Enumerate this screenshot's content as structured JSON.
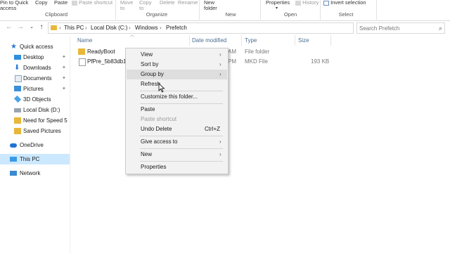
{
  "ribbon": {
    "pin_label": "Pin to Quick",
    "pin_label2": "access",
    "copy_label": "Copy",
    "paste_label": "Paste",
    "paste_shortcut_label": "Paste shortcut",
    "move_label": "Move",
    "move_label2": "to",
    "copy_to_label": "Copy",
    "copy_to_label2": "to",
    "delete_label": "Delete",
    "rename_label": "Rename",
    "new_folder_label": "New",
    "new_folder_label2": "folder",
    "properties_label": "Properties",
    "history_label": "History",
    "invert_label": "Invert selection",
    "groups": {
      "clipboard": "Clipboard",
      "organize": "Organize",
      "new": "New",
      "open": "Open",
      "select": "Select"
    }
  },
  "address": {
    "crumbs": [
      "This PC",
      "Local Disk (C:)",
      "Windows",
      "Prefetch"
    ],
    "search_placeholder": "Search Prefetch"
  },
  "sidebar": {
    "items": [
      {
        "label": "Quick access",
        "icon": "star-icon",
        "pinned": false
      },
      {
        "label": "Desktop",
        "icon": "desktop-icon",
        "pinned": true
      },
      {
        "label": "Downloads",
        "icon": "downloads-icon",
        "pinned": true
      },
      {
        "label": "Documents",
        "icon": "documents-icon",
        "pinned": true
      },
      {
        "label": "Pictures",
        "icon": "pictures-icon",
        "pinned": true
      },
      {
        "label": "3D Objects",
        "icon": "3d-objects-icon",
        "pinned": false
      },
      {
        "label": "Local Disk (D:)",
        "icon": "drive-icon",
        "pinned": false
      },
      {
        "label": "Need for Speed 5",
        "icon": "folder-icon",
        "pinned": false
      },
      {
        "label": "Saved Pictures",
        "icon": "folder-icon",
        "pinned": false
      },
      {
        "label": "OneDrive",
        "icon": "cloud-icon",
        "pinned": false
      },
      {
        "label": "This PC",
        "icon": "computer-icon",
        "pinned": false
      },
      {
        "label": "Network",
        "icon": "network-icon",
        "pinned": false
      }
    ]
  },
  "columns": {
    "name": "Name",
    "date": "Date modified",
    "type": "Type",
    "size": "Size"
  },
  "files": [
    {
      "name": "ReadyBoot",
      "date": "AM",
      "type": "File folder",
      "size": ""
    },
    {
      "name": "PfPre_5b83db13...",
      "date": "PM",
      "type": "MKD File",
      "size": "193 KB"
    }
  ],
  "context_menu": {
    "items": [
      {
        "label": "View"
      },
      {
        "label": "Sort by"
      },
      {
        "label": "Group by"
      },
      {
        "label": "Refresh"
      },
      {
        "label": "Customize this folder..."
      },
      {
        "label": "Paste"
      },
      {
        "label": "Paste shortcut"
      },
      {
        "label": "Undo Delete",
        "shortcut": "Ctrl+Z"
      },
      {
        "label": "Give access to"
      },
      {
        "label": "New"
      },
      {
        "label": "Properties"
      }
    ]
  },
  "colors": {
    "folder": "#e8b73a",
    "selection": "#cce8ff",
    "menu_bg": "#f2f2f2",
    "header_text": "#4d6e91"
  }
}
